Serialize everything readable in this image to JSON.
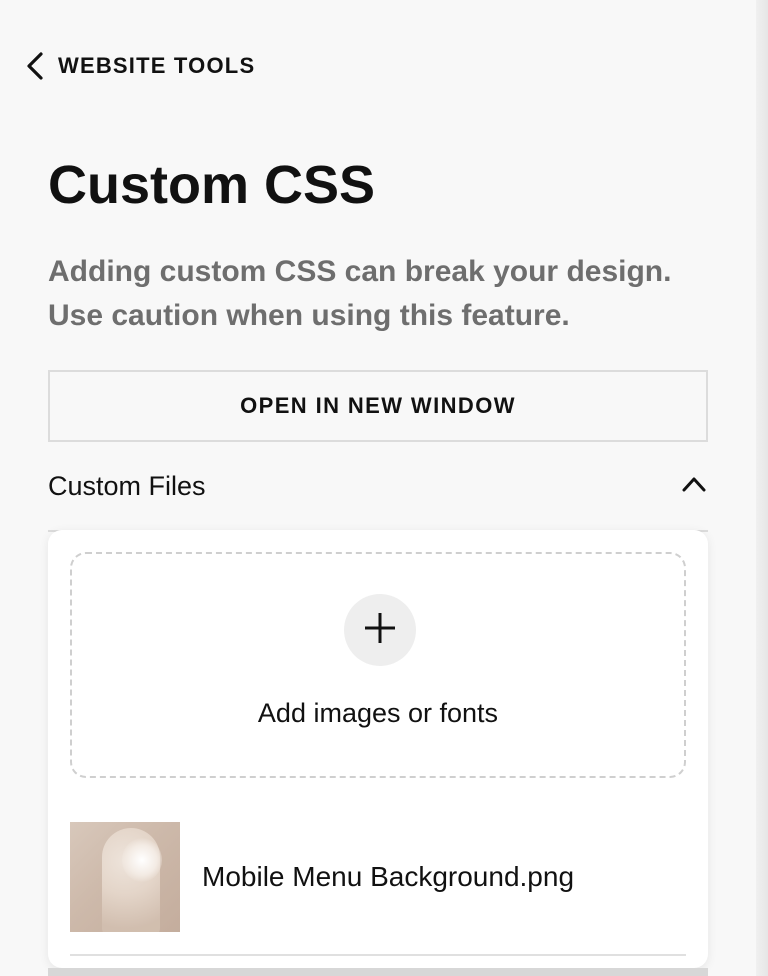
{
  "header": {
    "back_label": "WEBSITE TOOLS",
    "back_icon": "chevron-left-icon"
  },
  "page": {
    "title": "Custom CSS",
    "warning": "Adding custom CSS can break your design. Use caution when using this feature."
  },
  "actions": {
    "open_new_window_label": "OPEN IN NEW WINDOW"
  },
  "custom_files": {
    "title": "Custom Files",
    "toggle_icon": "chevron-up-icon",
    "expanded": true,
    "upload_label": "Add images or fonts",
    "upload_icon": "plus-icon",
    "files": [
      {
        "name": "Mobile Menu Background.png"
      }
    ]
  },
  "colors": {
    "background": "#f8f8f8",
    "text": "#111111",
    "muted_text": "#6e6e6e",
    "border": "#dcdcdc",
    "card": "#ffffff"
  }
}
